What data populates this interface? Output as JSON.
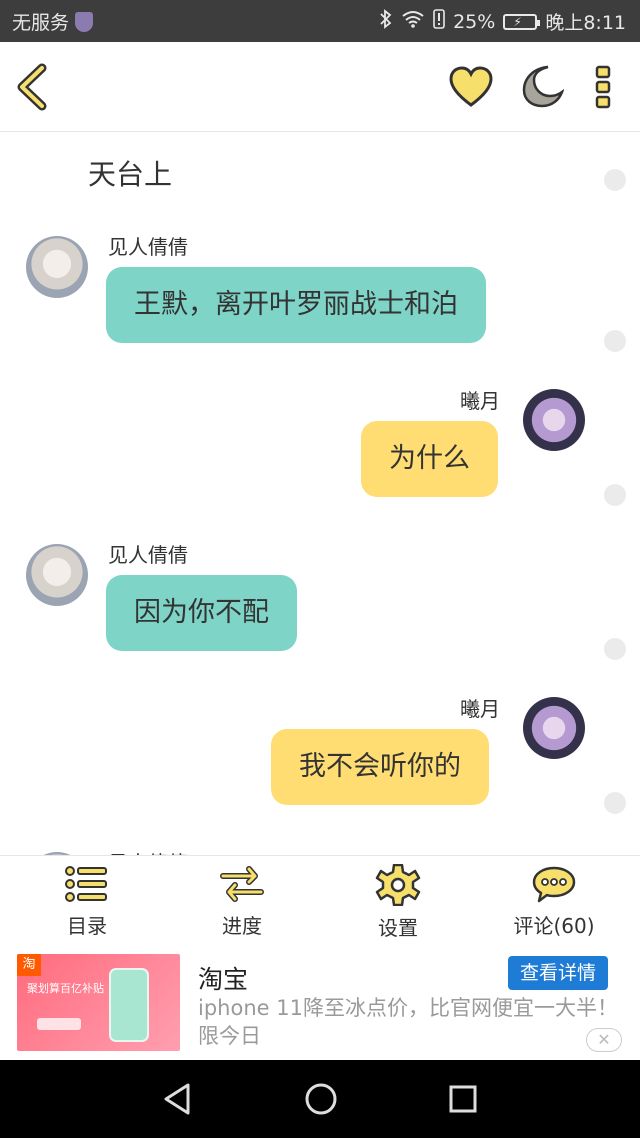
{
  "status_bar": {
    "carrier": "无服务",
    "battery": "25%",
    "time": "晚上8:11"
  },
  "toolbar": {
    "icons": [
      "back-icon",
      "heart-icon",
      "moon-icon",
      "more-icon"
    ],
    "accent_color": "#f6e06b"
  },
  "chat": {
    "chapter_title": "天台上",
    "messages": [
      {
        "side": "left",
        "speaker": "见人倩倩",
        "text": "王默，离开叶罗丽战士和泊",
        "color": "#7fd4c8"
      },
      {
        "side": "right",
        "speaker": "曦月",
        "text": "为什么",
        "color": "#ffdd73"
      },
      {
        "side": "left",
        "speaker": "见人倩倩",
        "text": "因为你不配",
        "color": "#7fd4c8"
      },
      {
        "side": "right",
        "speaker": "曦月",
        "text": "我不会听你的",
        "color": "#ffdd73"
      },
      {
        "side": "left",
        "speaker": "见人倩倩",
        "text": "",
        "color": "#7fd4c8"
      }
    ]
  },
  "bottom_nav": {
    "items": [
      {
        "label": "目录",
        "icon": "list-icon"
      },
      {
        "label": "进度",
        "icon": "swap-arrows-icon"
      },
      {
        "label": "设置",
        "icon": "gear-icon"
      },
      {
        "label": "评论(60)",
        "icon": "comment-icon"
      }
    ]
  },
  "ad": {
    "title": "淘宝",
    "description": "iphone 11降至冰点价，比官网便宜一大半！限今日",
    "button": "查看详情",
    "close": "✕",
    "image_text": "聚划算百亿补贴",
    "image_tag": "淘"
  },
  "system_nav": {
    "icons": [
      "back-triangle-icon",
      "home-circle-icon",
      "recents-square-icon"
    ]
  }
}
